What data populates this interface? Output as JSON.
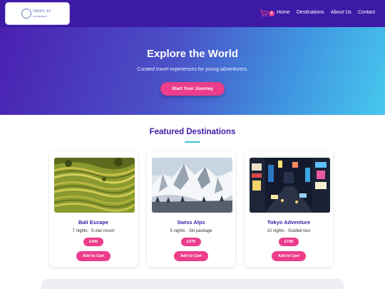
{
  "navbar": {
    "logo_line1": "TRIPS AT",
    "logo_line2": "LOW BUDGET",
    "cart_count": "0",
    "links": [
      "Home",
      "Destinations",
      "About Us",
      "Contact"
    ]
  },
  "hero": {
    "title": "Explore the World",
    "subtitle": "Curated travel experiences for young adventurers.",
    "cta_label": "Start Your Journey"
  },
  "featured": {
    "title": "Featured Destinations",
    "cards": [
      {
        "name": "Bali Escape",
        "desc": "7 nights · 5-star resort",
        "price": "£499",
        "button": "Add to Cart",
        "image": "rice-terraces"
      },
      {
        "name": "Swiss Alps",
        "desc": "5 nights · Ski package",
        "price": "£379",
        "button": "Add to Cart",
        "image": "snowy-mountains"
      },
      {
        "name": "Tokyo Adventure",
        "desc": "10 nights · Guided tour",
        "price": "£749",
        "button": "Add to Cart",
        "image": "night-city-street"
      }
    ]
  },
  "colors": {
    "brand_purple": "#3c1aa6",
    "accent_pink": "#ec3d8c",
    "accent_teal": "#3cc4d8"
  }
}
